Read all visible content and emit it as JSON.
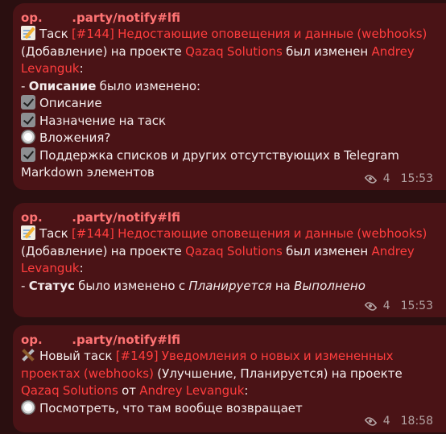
{
  "messages": [
    {
      "sender": "op.       .party/notify#lfi",
      "views": "4",
      "time": "15:53",
      "emoji": "memo",
      "part1": "Таск",
      "link1": "[#144] Недостающие оповещения и данные (webhooks)",
      "part2": "(Добавление) на проекте",
      "link2": "Qazaq Solutions",
      "part3": "был изменен",
      "link3": "Andrey",
      "link3b": "Levanguk",
      "colon": ":",
      "change_prefix": "- ",
      "change_field": "Описание",
      "change_suffix": " было изменено:",
      "checklist": [
        {
          "state": "checked",
          "text": "Описание"
        },
        {
          "state": "checked",
          "text": "Назначение на таск"
        },
        {
          "state": "unchecked",
          "text": "Вложения?"
        },
        {
          "state": "checked",
          "text": "Поддержка списков и других отсутствующих в Telegram"
        }
      ],
      "checklist_tail": "Markdown элементов"
    },
    {
      "sender": "op.       .party/notify#lfi",
      "views": "4",
      "time": "15:53",
      "emoji": "memo",
      "part1": "Таск",
      "link1": "[#144] Недостающие оповещения и данные (webhooks)",
      "part2": "(Добавление) на проекте",
      "link2": "Qazaq Solutions",
      "part3": "был изменен",
      "link3": "Andrey",
      "link3b": "Levanguk",
      "colon": ":",
      "status_prefix": "- ",
      "status_field": "Статус",
      "status_mid": " было изменено с ",
      "status_from": "Планируется",
      "status_to_word": " на ",
      "status_to": "Выполнено"
    },
    {
      "sender": "op.       .party/notify#lfi",
      "views": "4",
      "time": "18:58",
      "emoji": "hammer-and-wrench",
      "part1": "Новый таск",
      "link1": "[#149] Уведомления о новых и измененных",
      "link1b": "проектах (webhooks)",
      "part2": "(Улучшение, Планируется) на проекте",
      "link2": "Qazaq Solutions",
      "part3": "от",
      "link3": "Andrey Levanguk",
      "colon": ":",
      "todo": {
        "state": "unchecked",
        "text": "Посмотреть, что там вообще возвращает"
      }
    }
  ]
}
